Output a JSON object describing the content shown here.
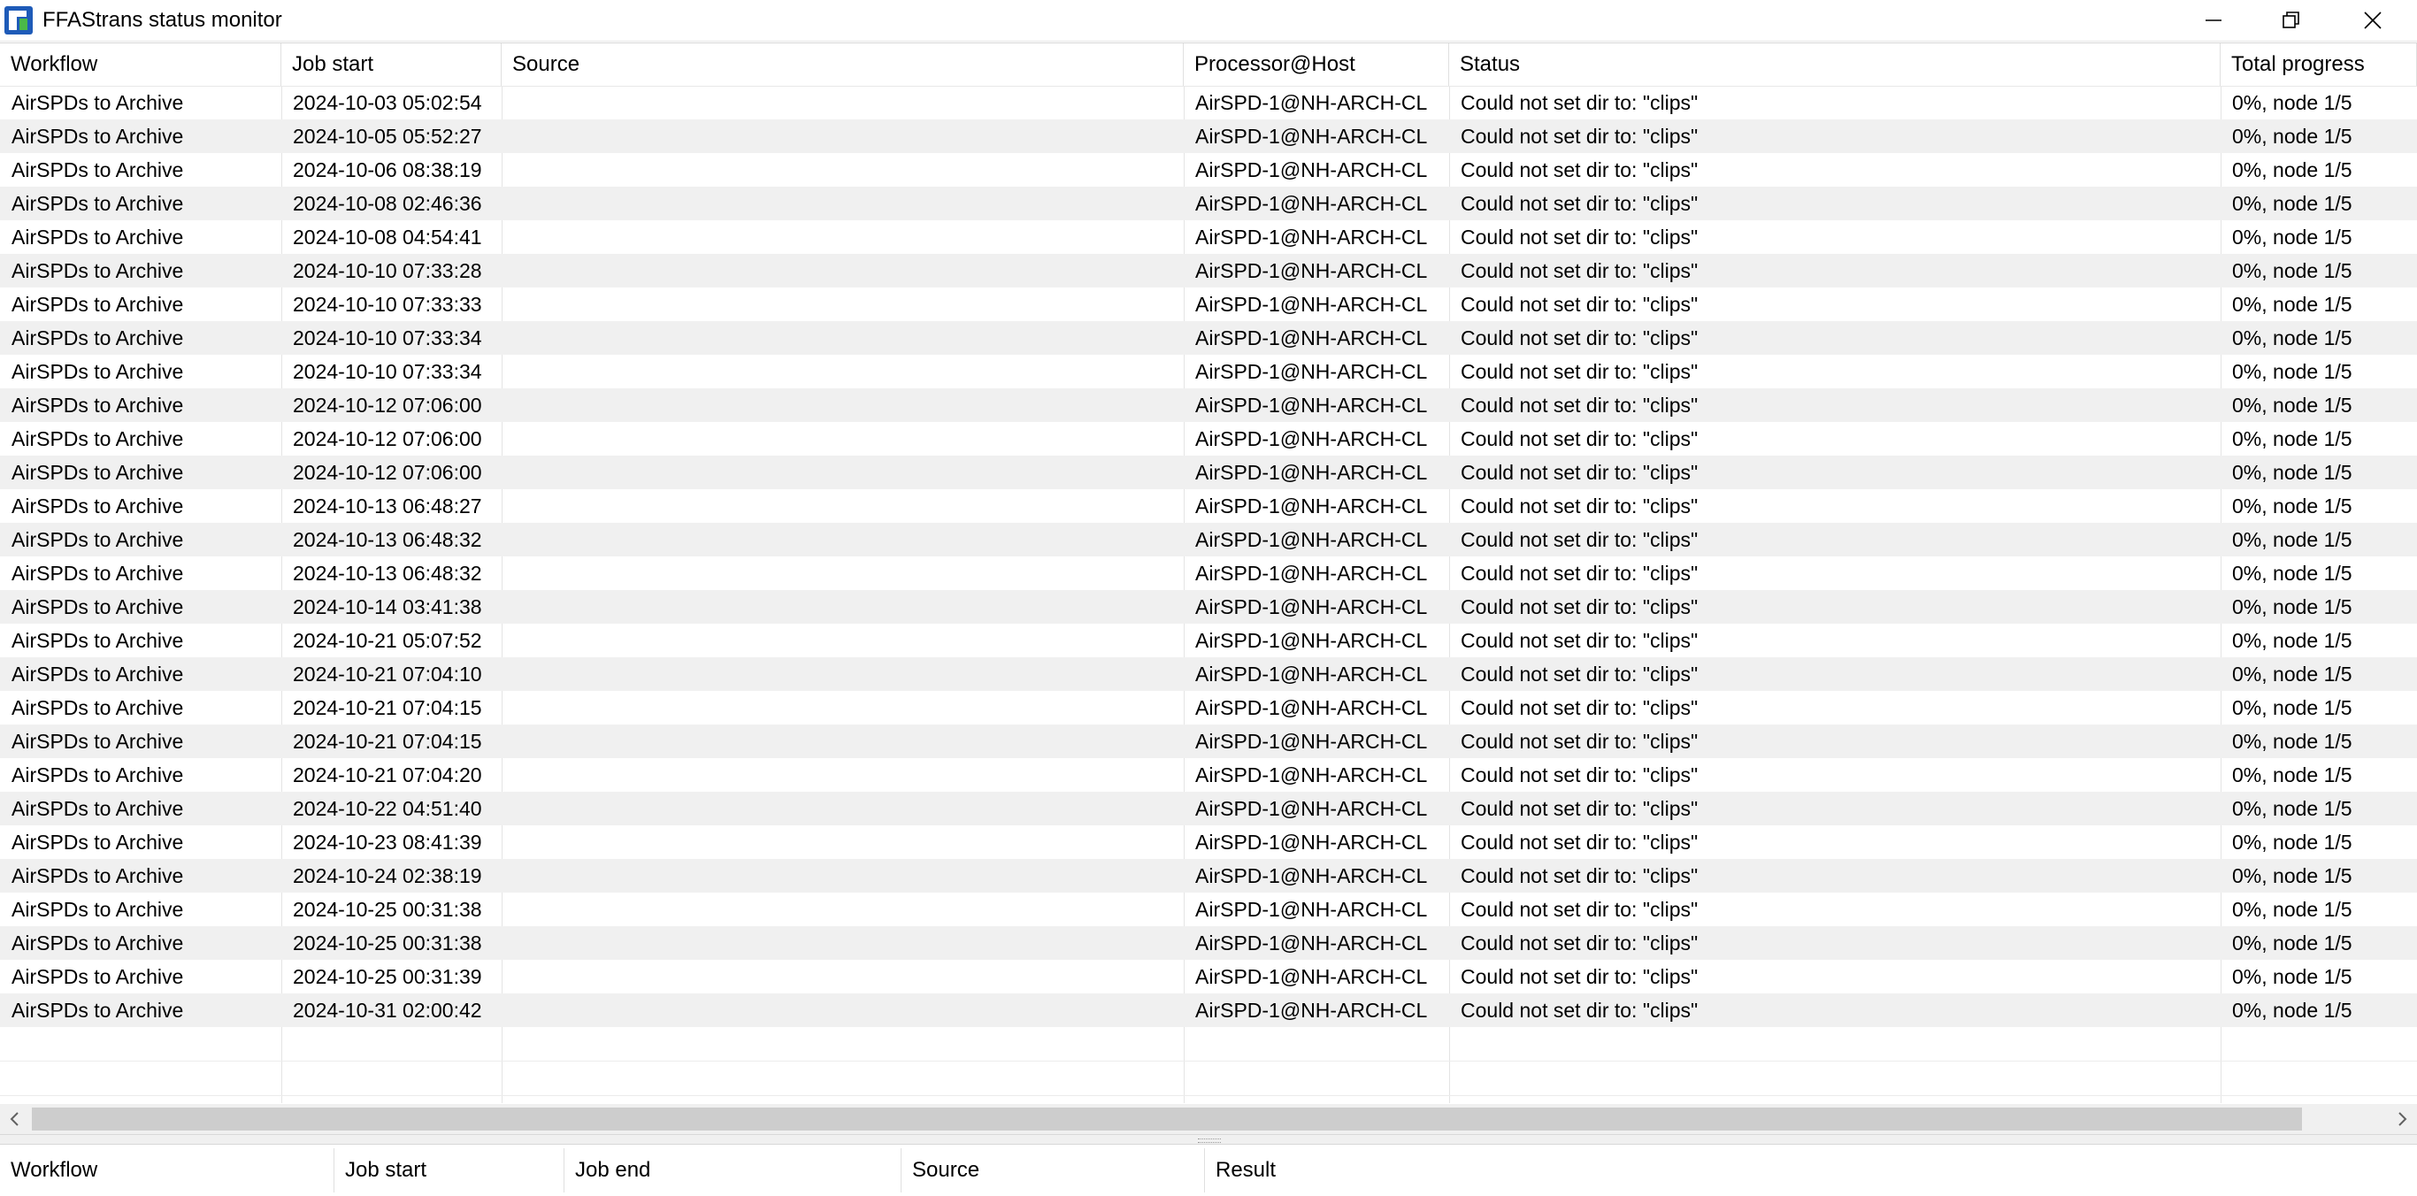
{
  "window": {
    "title": "FFAStrans status monitor"
  },
  "jobs": {
    "columns": [
      "Workflow",
      "Job start",
      "Source",
      "Processor@Host",
      "Status",
      "Total progress"
    ],
    "rows": [
      [
        "AirSPDs to Archive",
        "2024-10-03 05:02:54",
        "",
        "AirSPD-1@NH-ARCH-CL",
        "Could not set dir to: \"clips\"",
        "0%, node 1/5"
      ],
      [
        "AirSPDs to Archive",
        "2024-10-05 05:52:27",
        "",
        "AirSPD-1@NH-ARCH-CL",
        "Could not set dir to: \"clips\"",
        "0%, node 1/5"
      ],
      [
        "AirSPDs to Archive",
        "2024-10-06 08:38:19",
        "",
        "AirSPD-1@NH-ARCH-CL",
        "Could not set dir to: \"clips\"",
        "0%, node 1/5"
      ],
      [
        "AirSPDs to Archive",
        "2024-10-08 02:46:36",
        "",
        "AirSPD-1@NH-ARCH-CL",
        "Could not set dir to: \"clips\"",
        "0%, node 1/5"
      ],
      [
        "AirSPDs to Archive",
        "2024-10-08 04:54:41",
        "",
        "AirSPD-1@NH-ARCH-CL",
        "Could not set dir to: \"clips\"",
        "0%, node 1/5"
      ],
      [
        "AirSPDs to Archive",
        "2024-10-10 07:33:28",
        "",
        "AirSPD-1@NH-ARCH-CL",
        "Could not set dir to: \"clips\"",
        "0%, node 1/5"
      ],
      [
        "AirSPDs to Archive",
        "2024-10-10 07:33:33",
        "",
        "AirSPD-1@NH-ARCH-CL",
        "Could not set dir to: \"clips\"",
        "0%, node 1/5"
      ],
      [
        "AirSPDs to Archive",
        "2024-10-10 07:33:34",
        "",
        "AirSPD-1@NH-ARCH-CL",
        "Could not set dir to: \"clips\"",
        "0%, node 1/5"
      ],
      [
        "AirSPDs to Archive",
        "2024-10-10 07:33:34",
        "",
        "AirSPD-1@NH-ARCH-CL",
        "Could not set dir to: \"clips\"",
        "0%, node 1/5"
      ],
      [
        "AirSPDs to Archive",
        "2024-10-12 07:06:00",
        "",
        "AirSPD-1@NH-ARCH-CL",
        "Could not set dir to: \"clips\"",
        "0%, node 1/5"
      ],
      [
        "AirSPDs to Archive",
        "2024-10-12 07:06:00",
        "",
        "AirSPD-1@NH-ARCH-CL",
        "Could not set dir to: \"clips\"",
        "0%, node 1/5"
      ],
      [
        "AirSPDs to Archive",
        "2024-10-12 07:06:00",
        "",
        "AirSPD-1@NH-ARCH-CL",
        "Could not set dir to: \"clips\"",
        "0%, node 1/5"
      ],
      [
        "AirSPDs to Archive",
        "2024-10-13 06:48:27",
        "",
        "AirSPD-1@NH-ARCH-CL",
        "Could not set dir to: \"clips\"",
        "0%, node 1/5"
      ],
      [
        "AirSPDs to Archive",
        "2024-10-13 06:48:32",
        "",
        "AirSPD-1@NH-ARCH-CL",
        "Could not set dir to: \"clips\"",
        "0%, node 1/5"
      ],
      [
        "AirSPDs to Archive",
        "2024-10-13 06:48:32",
        "",
        "AirSPD-1@NH-ARCH-CL",
        "Could not set dir to: \"clips\"",
        "0%, node 1/5"
      ],
      [
        "AirSPDs to Archive",
        "2024-10-14 03:41:38",
        "",
        "AirSPD-1@NH-ARCH-CL",
        "Could not set dir to: \"clips\"",
        "0%, node 1/5"
      ],
      [
        "AirSPDs to Archive",
        "2024-10-21 05:07:52",
        "",
        "AirSPD-1@NH-ARCH-CL",
        "Could not set dir to: \"clips\"",
        "0%, node 1/5"
      ],
      [
        "AirSPDs to Archive",
        "2024-10-21 07:04:10",
        "",
        "AirSPD-1@NH-ARCH-CL",
        "Could not set dir to: \"clips\"",
        "0%, node 1/5"
      ],
      [
        "AirSPDs to Archive",
        "2024-10-21 07:04:15",
        "",
        "AirSPD-1@NH-ARCH-CL",
        "Could not set dir to: \"clips\"",
        "0%, node 1/5"
      ],
      [
        "AirSPDs to Archive",
        "2024-10-21 07:04:15",
        "",
        "AirSPD-1@NH-ARCH-CL",
        "Could not set dir to: \"clips\"",
        "0%, node 1/5"
      ],
      [
        "AirSPDs to Archive",
        "2024-10-21 07:04:20",
        "",
        "AirSPD-1@NH-ARCH-CL",
        "Could not set dir to: \"clips\"",
        "0%, node 1/5"
      ],
      [
        "AirSPDs to Archive",
        "2024-10-22 04:51:40",
        "",
        "AirSPD-1@NH-ARCH-CL",
        "Could not set dir to: \"clips\"",
        "0%, node 1/5"
      ],
      [
        "AirSPDs to Archive",
        "2024-10-23 08:41:39",
        "",
        "AirSPD-1@NH-ARCH-CL",
        "Could not set dir to: \"clips\"",
        "0%, node 1/5"
      ],
      [
        "AirSPDs to Archive",
        "2024-10-24 02:38:19",
        "",
        "AirSPD-1@NH-ARCH-CL",
        "Could not set dir to: \"clips\"",
        "0%, node 1/5"
      ],
      [
        "AirSPDs to Archive",
        "2024-10-25 00:31:38",
        "",
        "AirSPD-1@NH-ARCH-CL",
        "Could not set dir to: \"clips\"",
        "0%, node 1/5"
      ],
      [
        "AirSPDs to Archive",
        "2024-10-25 00:31:38",
        "",
        "AirSPD-1@NH-ARCH-CL",
        "Could not set dir to: \"clips\"",
        "0%, node 1/5"
      ],
      [
        "AirSPDs to Archive",
        "2024-10-25 00:31:39",
        "",
        "AirSPD-1@NH-ARCH-CL",
        "Could not set dir to: \"clips\"",
        "0%, node 1/5"
      ],
      [
        "AirSPDs to Archive",
        "2024-10-31 02:00:42",
        "",
        "AirSPD-1@NH-ARCH-CL",
        "Could not set dir to: \"clips\"",
        "0%, node 1/5"
      ]
    ]
  },
  "history": {
    "columns": [
      "Workflow",
      "Job start",
      "Job end",
      "Source",
      "Result"
    ]
  },
  "icons": {
    "app": "ffastrans-app-icon",
    "minimize": "minimize-icon",
    "restore": "restore-icon",
    "close": "close-icon",
    "scroll_left": "chevron-left-icon",
    "scroll_right": "chevron-right-icon"
  },
  "colors": {
    "alt_row": "#f0f0f0",
    "scroll_thumb": "#cdcdcd",
    "icon_blue": "#1e5bb8",
    "icon_green": "#4bb848"
  }
}
